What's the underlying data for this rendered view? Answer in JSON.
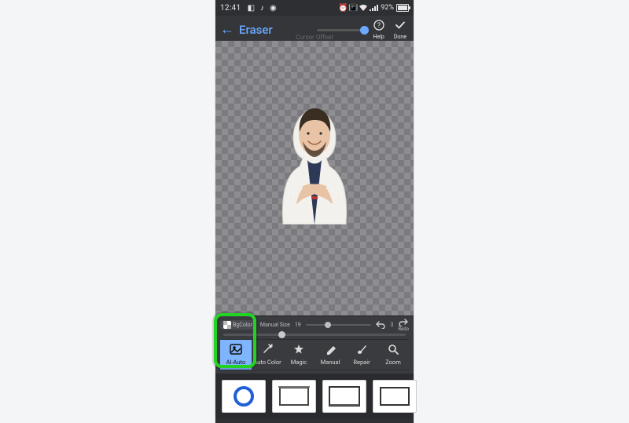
{
  "statusbar": {
    "time": "12:41",
    "left_icons": [
      "gallery",
      "tiktok",
      "messenger"
    ],
    "right_icons": [
      "alarm",
      "vibrate",
      "wifi",
      "signal"
    ],
    "battery_pct": "92%"
  },
  "header": {
    "title": "Eraser",
    "offset_label": "Cursor Offset",
    "help_label": "Help",
    "done_label": "Done"
  },
  "params": {
    "bgcolor_label": "BgColor",
    "manual_label": "Manual Size",
    "brush_value": "19",
    "redo_count": "3",
    "redo_label": "Redo"
  },
  "modes": {
    "ai_auto": "AI-Auto",
    "auto_color": "Auto Color",
    "magic": "Magic",
    "manual": "Manual",
    "repair": "Repair",
    "zoom": "Zoom",
    "active": "ai_auto"
  },
  "carousel": {
    "items": [
      "ring-blue",
      "frame-1",
      "frame-2",
      "frame-3"
    ]
  },
  "highlight": {
    "target": "ai_auto"
  },
  "colors": {
    "accent": "#6aa9ff",
    "highlight": "#23d323",
    "active_bg": "#7fb5ff"
  }
}
